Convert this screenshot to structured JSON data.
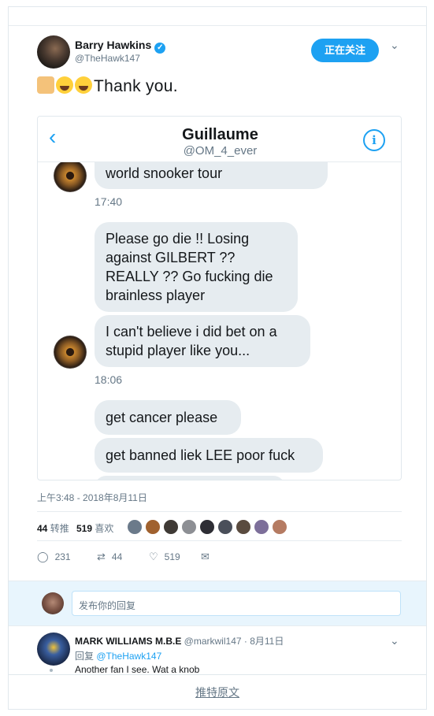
{
  "tweet": {
    "author_name": "Barry Hawkins",
    "author_handle": "@TheHawk147",
    "follow_label": "正在关注",
    "text": "Thank you.",
    "timestamp": "上午3:48 - 2018年8月11日",
    "retweets_count": "44",
    "retweets_label": "转推",
    "likes_count": "519",
    "likes_label": "喜欢",
    "action_reply_count": "231",
    "action_retweet_count": "44",
    "action_like_count": "519"
  },
  "dm": {
    "name": "Guillaume",
    "handle": "@OM_4_ever",
    "messages": [
      "world snooker tour",
      "Please go die !! Losing against GILBERT ?? REALLY ?? Go fucking die brainless player",
      "I can't believe i did bet on a stupid player like you...",
      "get cancer please",
      "get banned liek LEE poor fuck"
    ],
    "time1": "17:40",
    "time2": "18:06"
  },
  "reply_box": {
    "placeholder": "发布你的回复"
  },
  "reply": {
    "name": "MARK WILLIAMS M.B.E",
    "handle_date": "@markwil147 · 8月11日",
    "reply_to_prefix": "回复",
    "reply_to_handle": "@TheHawk147",
    "text": "Another fan I see.  Wat a knob"
  },
  "footer": {
    "link": "推特原文"
  },
  "colors": {
    "accent": "#1da1f2",
    "bubble": "#e6ecf0",
    "muted": "#657786"
  }
}
